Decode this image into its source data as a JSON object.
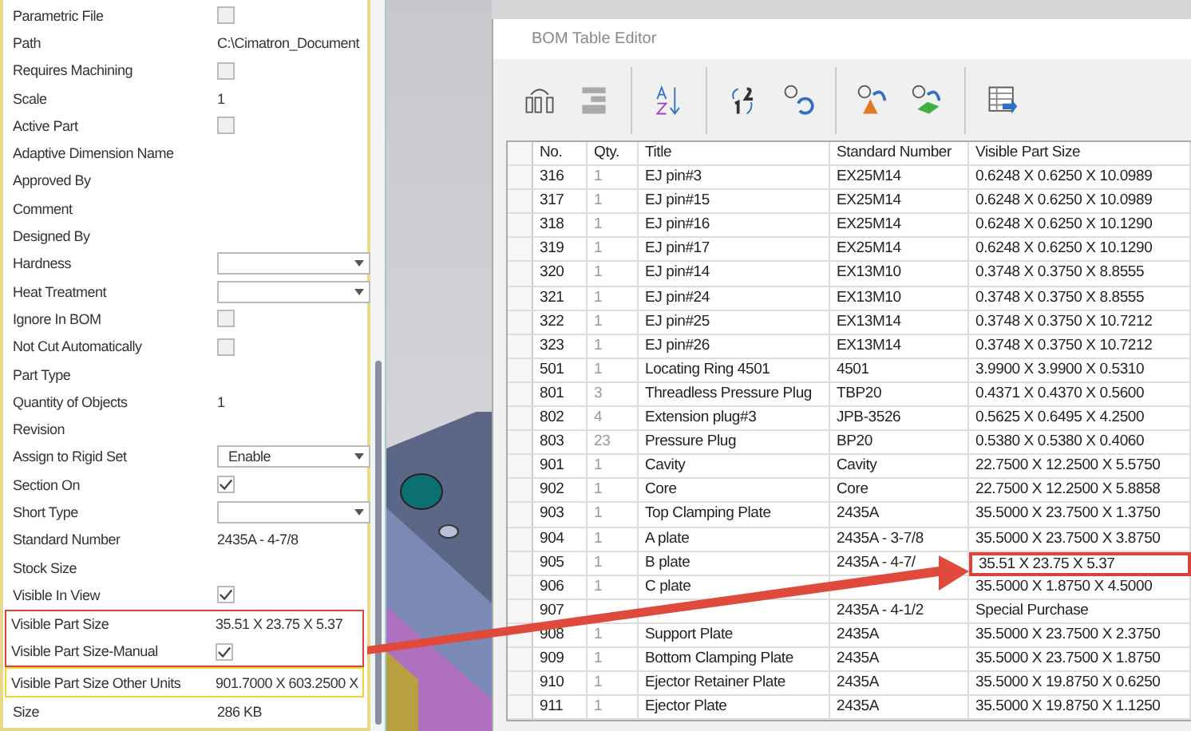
{
  "properties": [
    {
      "label": "Parametric File",
      "kind": "checkbox",
      "checked": false
    },
    {
      "label": "Path",
      "kind": "text",
      "value": "C:\\Cimatron_Document"
    },
    {
      "label": "Requires Machining",
      "kind": "checkbox",
      "checked": false
    },
    {
      "label": "Scale",
      "kind": "text",
      "value": "1"
    },
    {
      "label": "Active Part",
      "kind": "checkbox",
      "checked": false
    },
    {
      "label": "Adaptive Dimension Name",
      "kind": "empty"
    },
    {
      "label": "Approved By",
      "kind": "empty"
    },
    {
      "label": "Comment",
      "kind": "empty"
    },
    {
      "label": "Designed By",
      "kind": "empty"
    },
    {
      "label": "Hardness",
      "kind": "dropdown"
    },
    {
      "label": "Heat Treatment",
      "kind": "dropdown"
    },
    {
      "label": "Ignore In BOM",
      "kind": "checkbox",
      "checked": false
    },
    {
      "label": "Not Cut Automatically",
      "kind": "checkbox",
      "checked": false
    },
    {
      "label": "Part Type",
      "kind": "empty"
    },
    {
      "label": "Quantity of Objects",
      "kind": "text",
      "value": "1"
    },
    {
      "label": "Revision",
      "kind": "empty"
    },
    {
      "label": "Assign to Rigid Set",
      "kind": "dropdown",
      "value": "Enable"
    },
    {
      "label": "Section On",
      "kind": "checkbox",
      "checked": true
    },
    {
      "label": "Short Type",
      "kind": "dropdown"
    },
    {
      "label": "Standard Number",
      "kind": "text",
      "value": "2435A - 4-7/8"
    },
    {
      "label": "Stock Size",
      "kind": "empty"
    },
    {
      "label": "Visible In View",
      "kind": "checkbox",
      "checked": true
    },
    {
      "label": "Visible Part Size",
      "kind": "text",
      "value": "35.51 X 23.75 X 5.37",
      "color": "#d9443a"
    },
    {
      "label": "Visible Part Size-Manual",
      "kind": "checkbox",
      "checked": true,
      "color": "#d9443a"
    },
    {
      "label": "Visible Part Size Other Units",
      "kind": "text",
      "value": "901.7000 X 603.2500 X",
      "color": "#f2d530"
    },
    {
      "label": "Size",
      "kind": "text",
      "value": "286 KB"
    }
  ],
  "dialog": {
    "title": "BOM Table Editor",
    "columns": [
      "No.",
      "Qty.",
      "Title",
      "Standard Number",
      "Visible Part Size"
    ],
    "rows": [
      {
        "no": "316",
        "qty": "1",
        "title": "EJ pin#3",
        "standard": "EX25M14",
        "size": "0.6248 X 0.6250 X 10.0989",
        "highlighted": false
      },
      {
        "no": "317",
        "qty": "1",
        "title": "EJ pin#15",
        "standard": "EX25M14",
        "size": "0.6248 X 0.6250 X 10.0989",
        "highlighted": false
      },
      {
        "no": "318",
        "qty": "1",
        "title": "EJ pin#16",
        "standard": "EX25M14",
        "size": "0.6248 X 0.6250 X 10.1290",
        "highlighted": false
      },
      {
        "no": "319",
        "qty": "1",
        "title": "EJ pin#17",
        "standard": "EX25M14",
        "size": "0.6248 X 0.6250 X 10.1290",
        "highlighted": false
      },
      {
        "no": "320",
        "qty": "1",
        "title": "EJ pin#14",
        "standard": "EX13M10",
        "size": "0.3748 X 0.3750 X 8.8555",
        "highlighted": false
      },
      {
        "no": "321",
        "qty": "1",
        "title": "EJ pin#24",
        "standard": "EX13M10",
        "size": "0.3748 X 0.3750 X 8.8555",
        "highlighted": false
      },
      {
        "no": "322",
        "qty": "1",
        "title": "EJ pin#25",
        "standard": "EX13M14",
        "size": "0.3748 X 0.3750 X 10.7212",
        "highlighted": false
      },
      {
        "no": "323",
        "qty": "1",
        "title": "EJ pin#26",
        "standard": "EX13M14",
        "size": "0.3748 X 0.3750 X 10.7212",
        "highlighted": false
      },
      {
        "no": "501",
        "qty": "1",
        "title": "Locating Ring 4501",
        "standard": "4501",
        "size": "3.9900 X 3.9900 X 0.5310",
        "highlighted": false
      },
      {
        "no": "801",
        "qty": "3",
        "title": "Threadless Pressure Plug",
        "standard": "TBP20",
        "size": "0.4371 X 0.4370 X 0.5600",
        "highlighted": false
      },
      {
        "no": "802",
        "qty": "4",
        "title": "Extension plug#3",
        "standard": "JPB-3526",
        "size": "0.5625 X 0.6495 X 4.2500",
        "highlighted": false
      },
      {
        "no": "803",
        "qty": "23",
        "title": "Pressure Plug",
        "standard": "BP20",
        "size": "0.5380 X 0.5380 X 0.4060",
        "highlighted": false
      },
      {
        "no": "901",
        "qty": "1",
        "title": "Cavity",
        "standard": "Cavity",
        "size": "22.7500 X 12.2500 X 5.5750",
        "highlighted": false
      },
      {
        "no": "902",
        "qty": "1",
        "title": "Core",
        "standard": "Core",
        "size": "22.7500 X 12.2500 X 5.8858",
        "highlighted": false
      },
      {
        "no": "903",
        "qty": "1",
        "title": "Top Clamping Plate",
        "standard": "2435A",
        "size": "35.5000 X 23.7500 X 1.3750",
        "highlighted": false
      },
      {
        "no": "904",
        "qty": "1",
        "title": "A plate",
        "standard": "2435A - 3-7/8",
        "size": "35.5000 X 23.7500 X 3.8750",
        "highlighted": false
      },
      {
        "no": "905",
        "qty": "1",
        "title": "B plate",
        "standard": "2435A - 4-7/",
        "size": "35.51 X 23.75 X 5.37",
        "highlighted": true
      },
      {
        "no": "906",
        "qty": "1",
        "title": "C plate",
        "size": "35.5000 X 1.8750 X 4.5000",
        "highlighted": false
      },
      {
        "no": "907",
        "standard": "2435A - 4-1/2",
        "size": "Special Purchase",
        "highlighted": false
      },
      {
        "no": "908",
        "qty": "1",
        "title": "Support Plate",
        "standard": "2435A",
        "size": "35.5000 X 23.7500 X 2.3750",
        "highlighted": false
      },
      {
        "no": "909",
        "qty": "1",
        "title": "Bottom Clamping Plate",
        "standard": "2435A",
        "size": "35.5000 X 23.7500 X 1.8750",
        "highlighted": false
      },
      {
        "no": "910",
        "qty": "1",
        "title": "Ejector Retainer Plate",
        "standard": "2435A",
        "size": "35.5000 X 19.8750 X 0.6250",
        "highlighted": false
      },
      {
        "no": "911",
        "qty": "1",
        "title": "Ejector Plate",
        "standard": "2435A",
        "size": "35.5000 X 19.8750 X 1.1250",
        "highlighted": false
      }
    ]
  }
}
